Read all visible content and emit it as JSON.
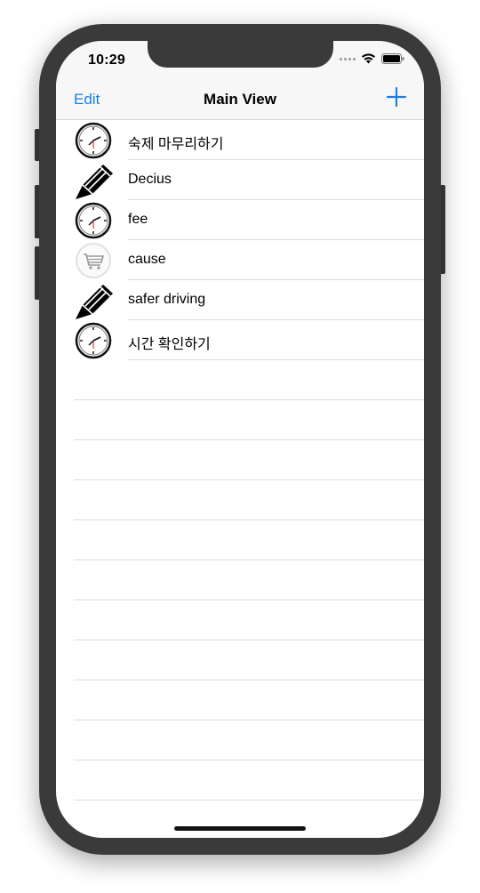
{
  "status_bar": {
    "time": "10:29"
  },
  "nav": {
    "edit_label": "Edit",
    "title": "Main View",
    "add_icon": "plus-icon"
  },
  "colors": {
    "accent": "#1a7fe0"
  },
  "rows": [
    {
      "label": "숙제 마무리하기",
      "icon": "clock-icon"
    },
    {
      "label": "Decius",
      "icon": "pencil-icon"
    },
    {
      "label": "fee",
      "icon": "clock-icon"
    },
    {
      "label": "cause",
      "icon": "shopping-cart-icon"
    },
    {
      "label": "safer driving",
      "icon": "pencil-icon"
    },
    {
      "label": "시간 확인하기",
      "icon": "clock-icon"
    }
  ]
}
